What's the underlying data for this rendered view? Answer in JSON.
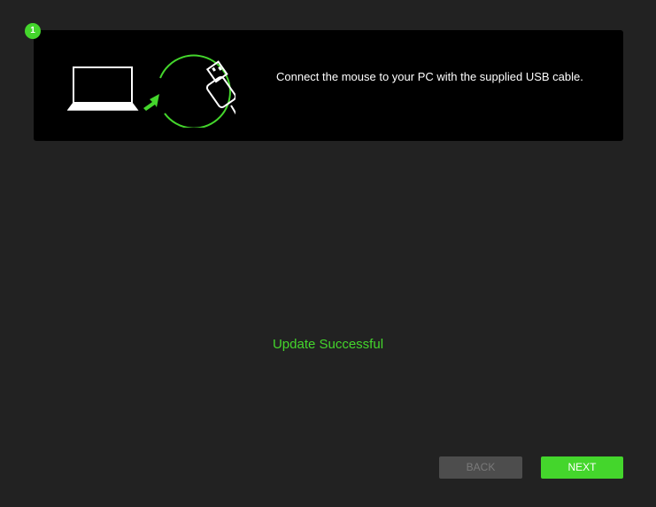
{
  "step": {
    "number": "1",
    "instruction": "Connect the mouse to your PC with the supplied USB cable.",
    "illustration_icons": [
      "laptop-icon",
      "arrow-icon",
      "usb-plug-icon"
    ]
  },
  "status": {
    "message": "Update Successful"
  },
  "buttons": {
    "back_label": "BACK",
    "next_label": "NEXT"
  },
  "colors": {
    "accent": "#44d62c",
    "background": "#222222",
    "card": "#000000",
    "disabled_button": "#4d4d4d"
  }
}
